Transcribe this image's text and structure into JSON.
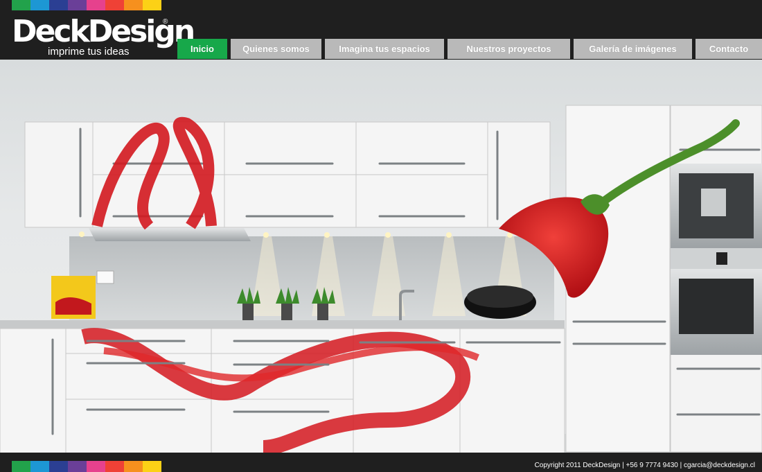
{
  "brand": {
    "name": "DeckDesign",
    "registered": "®",
    "tagline": "imprime tus ideas",
    "strip_colors": [
      "#22a24b",
      "#1d97d4",
      "#2b3f93",
      "#6a3f98",
      "#e6418d",
      "#ef4136",
      "#f6901e",
      "#fcd116"
    ]
  },
  "nav": {
    "items": [
      {
        "label": "Inicio",
        "active": true
      },
      {
        "label": "Quienes somos",
        "active": false
      },
      {
        "label": "Imagina tus espacios",
        "active": false
      },
      {
        "label": "Nuestros proyectos",
        "active": false
      },
      {
        "label": "Galería de imágenes",
        "active": false
      },
      {
        "label": "Contacto",
        "active": false
      }
    ],
    "active_color": "#17a84a",
    "inactive_color": "#b9b9b9"
  },
  "footer": {
    "copyright": "Copyright 2011 DeckDesign | +56 9 7774 9430 | cgarcia@deckdesign.cl"
  }
}
